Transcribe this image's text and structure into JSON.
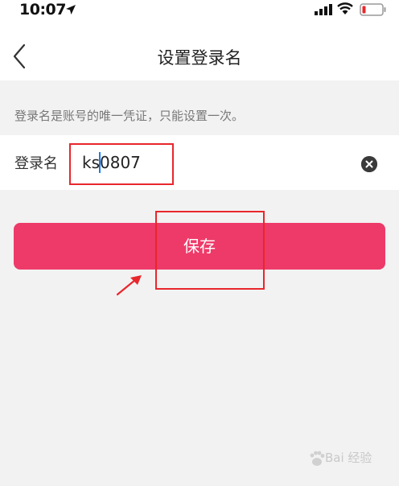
{
  "status_bar": {
    "time": "10:07",
    "icons": [
      "location-arrow-icon",
      "signal-icon",
      "wifi-icon",
      "battery-low-icon"
    ],
    "battery_color": "#e8272c"
  },
  "nav": {
    "title": "设置登录名",
    "back_icon": "chevron-left-icon"
  },
  "hint": "登录名是账号的唯一凭证，只能设置一次。",
  "form": {
    "label": "登录名",
    "value": "ks0807",
    "clear_icon": "clear-circle-icon"
  },
  "save_button": {
    "label": "保存",
    "color": "#ee3a69"
  },
  "annotations": {
    "color": "#e8272c"
  },
  "watermark": {
    "text": "Bai 经验",
    "icon": "paw-icon"
  }
}
